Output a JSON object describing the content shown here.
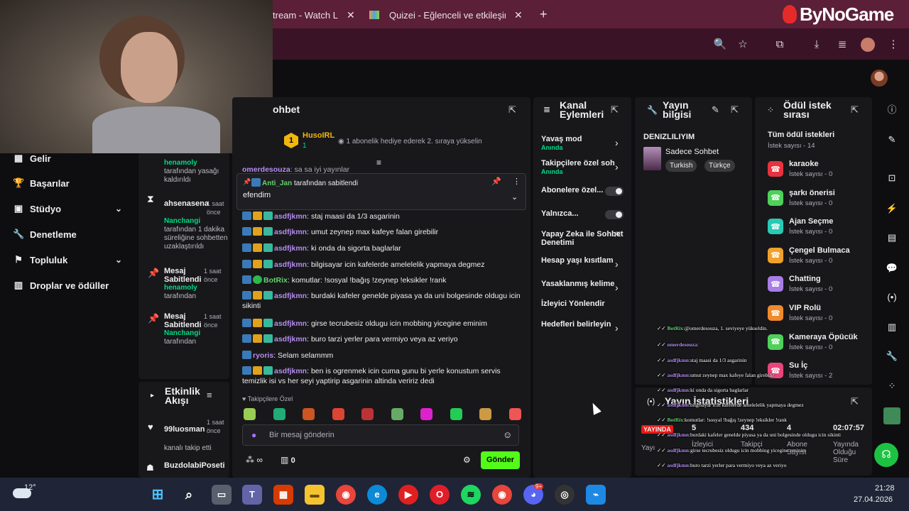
{
  "browser": {
    "tabs": [
      {
        "title": "tream - Watch Liv"
      },
      {
        "title": "Quizei - Eğlenceli ve etkileşimli"
      }
    ],
    "new_tab": "+",
    "close": "✕"
  },
  "watermark": "ByNoGame",
  "left_nav": {
    "items": [
      {
        "label": "Gelir",
        "icon": "coins-icon",
        "chev": false
      },
      {
        "label": "Başarılar",
        "icon": "trophy-icon",
        "chev": false
      },
      {
        "label": "Stüdyo",
        "icon": "studio-icon",
        "chev": true
      },
      {
        "label": "Denetleme",
        "icon": "wrench-icon",
        "chev": false
      },
      {
        "label": "Topluluk",
        "icon": "community-icon",
        "chev": true
      },
      {
        "label": "Droplar ve ödüller",
        "icon": "drops-icon",
        "chev": false
      }
    ]
  },
  "mod_log": {
    "items": [
      {
        "actor": "henamoly",
        "text": "tarafından yasağı kaldırıldı"
      },
      {
        "user": "ahsenasena",
        "time": "1 saat önce",
        "actor": "Nanchangi",
        "text": "tarafından 1 dakika süreliğine sohbetten uzaklaştırıldı"
      },
      {
        "title": "Mesaj Sabitlendi",
        "time": "1 saat önce",
        "actor": "henamoly",
        "text": "tarafından"
      },
      {
        "title": "Mesaj Sabitlendi",
        "time": "1 saat önce",
        "actor": "Nanchangi",
        "text": "tarafından"
      }
    ]
  },
  "activity": {
    "title": "Etkinlik Akışı",
    "items": [
      {
        "user": "99luosman",
        "time": "1 saat önce",
        "text": "kanalı takip etti"
      },
      {
        "user": "BuzdolabiPoseti",
        "time": "",
        "text": ""
      }
    ]
  },
  "chat": {
    "title": "ohbet",
    "hype_user": "HusoIRL",
    "hype_rank": "1",
    "hype_count": "1",
    "hype_text": "1 abonelik hediye ederek 2. sıraya yükselin",
    "prev_user": "omerdesouza",
    "prev_msg": ": sa sa iyi yayınlar",
    "pinned_by": "Anti_Jan",
    "pinned_suffix": "tarafından sabitlendi",
    "pinned_msg": "efendim",
    "messages": [
      {
        "user": "asdfjkmn",
        "color": "#b68cf0",
        "text": "staj maasi da 1/3 asgarinin"
      },
      {
        "user": "asdfjkmn",
        "color": "#b68cf0",
        "text": "umut zeynep max kafeye falan girebilir"
      },
      {
        "user": "asdfjkmn",
        "color": "#b68cf0",
        "text": "ki onda da sigorta baglarlar"
      },
      {
        "user": "asdfjkmn",
        "color": "#b68cf0",
        "text": "bilgisayar icin kafelerde amelelelik yapmaya degmez"
      },
      {
        "user": "BotRix",
        "color": "#63d36b",
        "text": "komutlar: !sosyal !bağış !zeynep !eksikler !rank"
      },
      {
        "user": "asdfjkmn",
        "color": "#b68cf0",
        "text": "burdaki kafeler genelde piyasa ya da uni bolgesinde oldugu icin sikinti"
      },
      {
        "user": "asdfjkmn",
        "color": "#b68cf0",
        "text": "girse tecrubesiz oldugu icin mobbing yicegine eminim"
      },
      {
        "user": "asdfjkmn",
        "color": "#b68cf0",
        "text": "buro tarzi yerler para vermiyo veya az veriyo"
      },
      {
        "user": "ryoris",
        "color": "#b68cf0",
        "text": "Selam selammm"
      },
      {
        "user": "asdfjkmn",
        "color": "#b68cf0",
        "text": "ben is ogrenmek icin cuma gunu bi yerle konustum servis temizlik isi vs her seyi yaptirip asgarinin altinda veririz dedi"
      }
    ],
    "emote_label": "Takipçilere Özel",
    "input_placeholder": "Bir mesaj gönderin",
    "points": "∞",
    "gift_count": "0",
    "send_label": "Gönder"
  },
  "actions": {
    "title": "Kanal Eylemleri",
    "items": [
      {
        "label": "Yavaş mod",
        "sub": "Anında",
        "control": "arrow"
      },
      {
        "label": "Takipçilere özel soh",
        "sub": "Anında",
        "control": "arrow"
      },
      {
        "label": "Abonelere özel...",
        "sub": "",
        "control": "toggle"
      },
      {
        "label": "Yalnızca...",
        "sub": "",
        "control": "toggle"
      },
      {
        "label": "Yapay Zeka ile Sohbet Denetimi",
        "sub": "",
        "control": "external"
      },
      {
        "label": "Hesap yaşı kısıtlam",
        "sub": "",
        "control": "arrow"
      },
      {
        "label": "Yasaklanmış kelime",
        "sub": "",
        "control": "arrow"
      },
      {
        "label": "İzleyici Yönlendir",
        "sub": "",
        "control": "none"
      },
      {
        "label": "Hedefleri belirleyin",
        "sub": "",
        "control": "arrow"
      }
    ]
  },
  "stream_info": {
    "title": "Yayın bilgisi",
    "channel": "DENIZLILIYIM",
    "category": "Sadece Sohbet",
    "tags": [
      "Turkish",
      "Türkçe"
    ]
  },
  "rewards": {
    "title": "Ödül istek sırası",
    "all": "Tüm ödül istekleri",
    "all_count": "İstek sayısı - 14",
    "items": [
      {
        "name": "karaoke",
        "count": "İstek sayısı - 0",
        "color": "#e8313e"
      },
      {
        "name": "şarkı önerisi",
        "count": "İstek sayısı - 0",
        "color": "#4ed15a"
      },
      {
        "name": "Ajan Seçme",
        "count": "İstek sayısı - 0",
        "color": "#28c9b5"
      },
      {
        "name": "Çengel Bulmaca",
        "count": "İstek sayısı - 0",
        "color": "#f0a12b"
      },
      {
        "name": "Chatting",
        "count": "İstek sayısı - 0",
        "color": "#a87ee6"
      },
      {
        "name": "VIP Rolü",
        "count": "İstek sayısı - 0",
        "color": "#f08a2b"
      },
      {
        "name": "Kameraya Öpücük",
        "count": "İstek sayısı - 0",
        "color": "#4ed15a"
      },
      {
        "name": "Su İç",
        "count": "İstek sayısı - 2",
        "color": "#e8467a"
      }
    ]
  },
  "stats": {
    "title": "Yayın İstatistikleri",
    "live": "YAYINDA",
    "values": [
      "5",
      "434",
      "4",
      "02:07:57"
    ],
    "labels": [
      "İzleyici",
      "Takipçi",
      "Abone Sayısı",
      "Yayında Olduğu Süre"
    ],
    "row_label": "Yayı"
  },
  "overlay_chat": [
    {
      "user": "BotRix",
      "color": "g",
      "text": "@omerdesouza, 1. seviyeye yükseldin."
    },
    {
      "user": "omerdesouza",
      "color": "u",
      "text": ""
    },
    {
      "user": "asdfjkmn",
      "color": "u",
      "text": "staj maasi da 1/3 asgarinin"
    },
    {
      "user": "asdfjkmn",
      "color": "u",
      "text": "umut zeynep max kafeye falan girebilir"
    },
    {
      "user": "asdfjkmn",
      "color": "u",
      "text": "ki onda da sigorta baglarlar"
    },
    {
      "user": "asdfjkmn",
      "color": "u",
      "text": "bilgisayar icin kafelerde amelelelik yapmaya degmez"
    },
    {
      "user": "BotRix",
      "color": "g",
      "text": "komutlar: !sosyal !bağış !zeynep !eksikler !rank"
    },
    {
      "user": "asdfjkmn",
      "color": "u",
      "text": "burdaki kafeler genelde piyasa ya da uni bolgesinde oldugu icin sikinti"
    },
    {
      "user": "asdfjkmn",
      "color": "u",
      "text": "girse tecrubesiz oldugu icin mobbing yicegine eminim"
    },
    {
      "user": "asdfjkmn",
      "color": "u",
      "text": "buro tarzi yerler para vermiyo veya az veriyo"
    },
    {
      "user": "ryoris",
      "color": "u",
      "text": "Selam selammm"
    },
    {
      "user": "asdfjkmn",
      "color": "u",
      "text": "ben is ogrenmek icin cuma gunu bi yerle konustum servis temizlik isi vs her seyi yaptirip asgarinin altinda veririz dedi"
    }
  ],
  "taskbar": {
    "temp": "12°",
    "time": "21:28",
    "date": "27.04.2026",
    "discord_badge": "9+"
  },
  "colors": {
    "accent": "#53fc18",
    "tabbar": "#5b1f38",
    "panel": "#18181b"
  }
}
